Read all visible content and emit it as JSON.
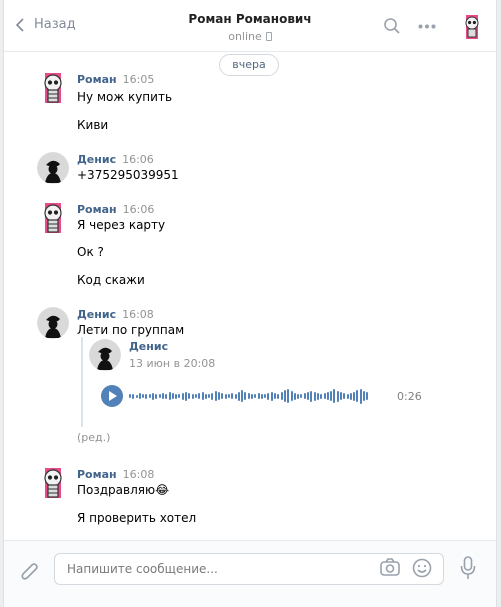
{
  "header": {
    "back_label": "Назад",
    "title": "Роман Романович",
    "status": "online"
  },
  "date_separator": "вчера",
  "messages": [
    {
      "author": "Роман",
      "time": "16:05",
      "lines": [
        "Ну мож купить",
        "Киви"
      ]
    },
    {
      "author": "Денис",
      "time": "16:06",
      "lines": [
        "+375295039951"
      ]
    },
    {
      "author": "Роман",
      "time": "16:06",
      "lines": [
        "Я через карту",
        "Ок ?",
        "Код скажи"
      ]
    },
    {
      "author": "Денис",
      "time": "16:08",
      "lines": [
        "Лети по группам"
      ],
      "forwarded": {
        "author": "Денис",
        "date": "13 июн в 20:08",
        "duration": "0:26"
      },
      "edited": "(ред.)"
    },
    {
      "author": "Роман",
      "time": "16:08",
      "lines": [
        "Поздравляю😂",
        "Я проверить хотел"
      ]
    }
  ],
  "composer": {
    "placeholder": "Напишите сообщение..."
  },
  "colors": {
    "accent": "#5181b8",
    "author": "#42648b"
  },
  "icons": [
    "back-icon",
    "search-icon",
    "more-icon",
    "paperclip-icon",
    "camera-icon",
    "smile-icon",
    "microphone-icon"
  ]
}
